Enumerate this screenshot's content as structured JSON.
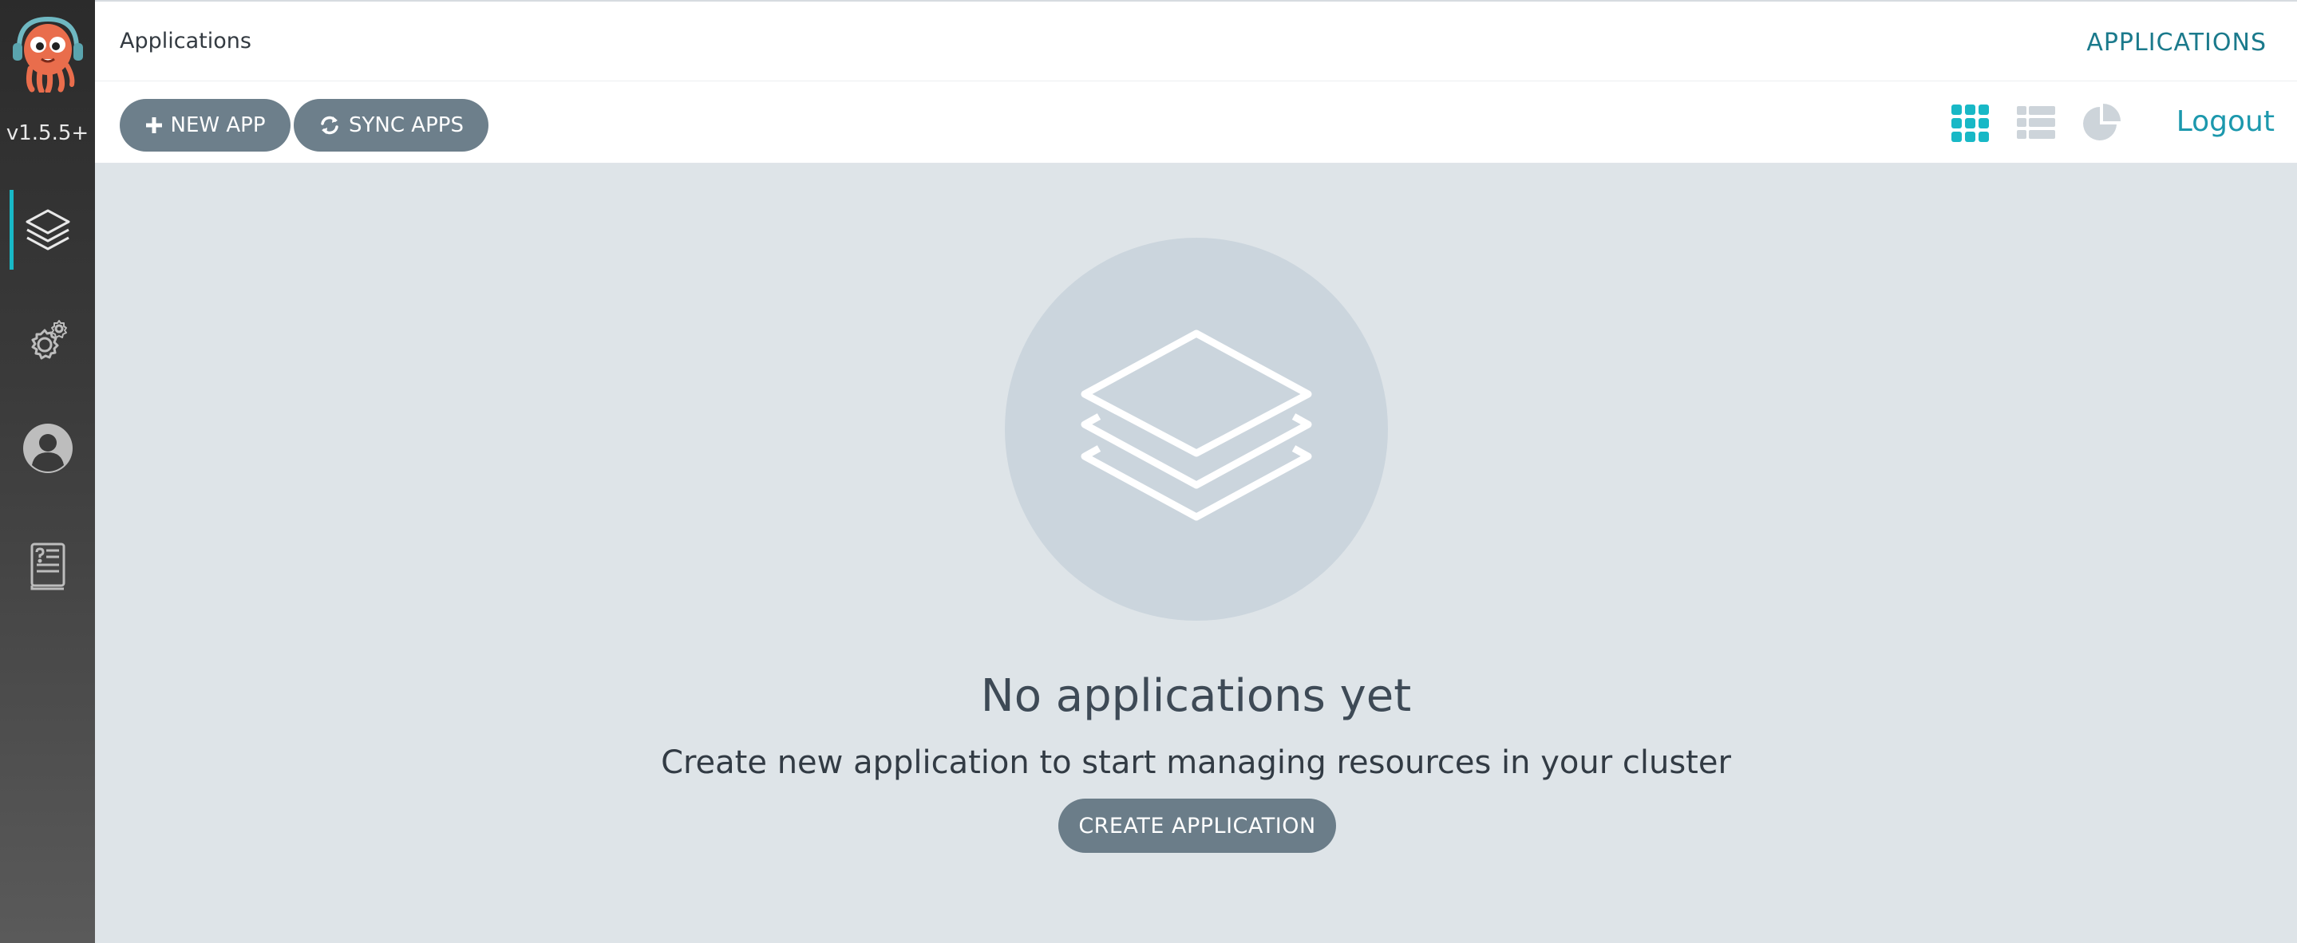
{
  "app": {
    "version": "v1.5.5+"
  },
  "sidebar": {
    "items": [
      {
        "name": "applications",
        "icon": "layers-icon",
        "active": true
      },
      {
        "name": "settings",
        "icon": "gears-icon",
        "active": false
      },
      {
        "name": "user-info",
        "icon": "user-icon",
        "active": false
      },
      {
        "name": "documentation",
        "icon": "docs-book-icon",
        "active": false
      }
    ]
  },
  "header": {
    "breadcrumb": "Applications",
    "page_tag": "APPLICATIONS"
  },
  "toolbar": {
    "new_app_label": "NEW APP",
    "sync_apps_label": "SYNC APPS",
    "views": [
      {
        "name": "tiles",
        "icon": "grid-icon",
        "active": true
      },
      {
        "name": "list",
        "icon": "list-icon",
        "active": false
      },
      {
        "name": "summary",
        "icon": "pie-chart-icon",
        "active": false
      }
    ],
    "logout_label": "Logout"
  },
  "empty_state": {
    "icon": "layers-icon",
    "title": "No applications yet",
    "subtitle": "Create new application to start managing resources in your cluster",
    "button_label": "CREATE APPLICATION"
  },
  "colors": {
    "accent": "#18b8c6",
    "link": "#1c98ad",
    "button": "#6d7f8b",
    "content_bg": "#dee4e8",
    "circle_bg": "#cbd5dd"
  }
}
